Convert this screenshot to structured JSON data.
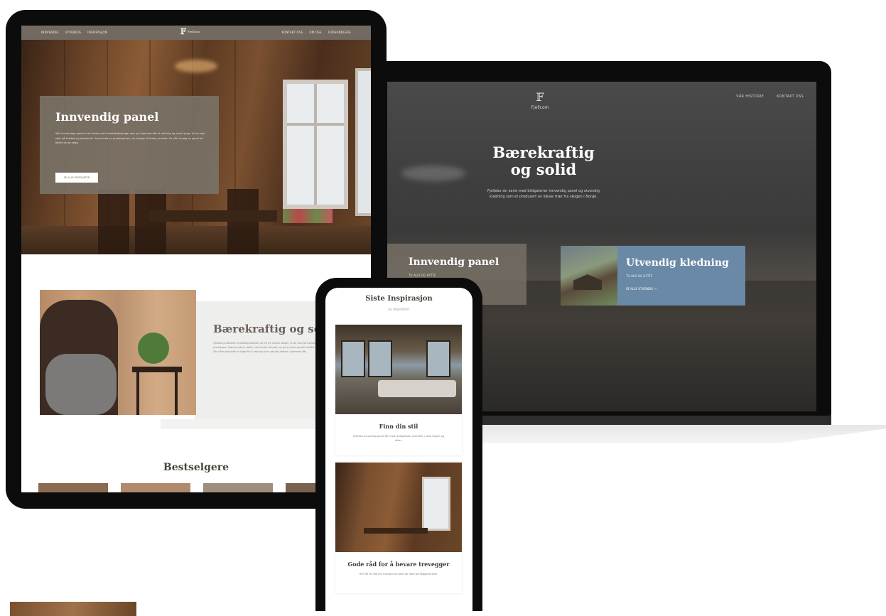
{
  "laptop": {
    "logo_name": "Fjellcom",
    "nav": [
      "VÅR HISTORIE",
      "KONTAKT OSS"
    ],
    "hero_title_line1": "Bærekraftig",
    "hero_title_line2": "og solid",
    "hero_text": "Fjellebo sin serie med bildgalerier innvendig panel og utvendig kledning som er produsert av lokale trær fra skogen i Norge.",
    "card_indoor": {
      "title": "Innvendig panel",
      "subtitle": "TIL ALLE OG HYTTE"
    },
    "card_outdoor": {
      "title": "Utvendig kledning",
      "subtitle": "TIL HUS OG HYTTE",
      "link": "SE ALLE UTVENDIG  →"
    }
  },
  "tablet": {
    "nav_left": [
      "INNVENDIG",
      "UTVENDIG",
      "INSPIRASJON"
    ],
    "nav_right": [
      "KONTAKT OSS",
      "OM OSS",
      "FORHANDLERE"
    ],
    "logo_name": "Fjellcom",
    "hero_title": "Innvendig panel",
    "hero_text": "Vårt innvendige panel er et utvalg med kvalitetsløsninger som gir hjemmet ditt et naturlig og varmt preg. Vi har lagt vekt på kvalitet og bærekraft i hvert ledd av produksjonen, fra skogen til ferdig produkt. Se vårt utvalg av panel for både tak og vegg.",
    "hero_button": "SE ALLE PRODUKTER",
    "section_title": "Bærekraftig og solid",
    "section_text": "Fjellebo produserer kvalitetsprodukter av tre fra norske skoger. Vi tar vare på naturen og sørger for bærekraftig produksjon. Trærne vokser sakte i det norske klimaet, og gir en solid og tett kvalitet som holder i mange år fremover. Alle våre produkter er laget for å vare og gi en naturlig følelse i hjemmet ditt.",
    "bestsellers_title": "Bestselgere"
  },
  "phone": {
    "title": "Siste Inspirasjon",
    "subtitle": "SE INSPIRERT",
    "cards": [
      {
        "title": "Finn din stil",
        "text": "Fjellebo innvendig panel får med ferdighilsen overflate i ulike farger og stiler."
      },
      {
        "title": "Gode råd for å bevare trevegger",
        "text": "Her får du råd om hvordan du best tar vare på veggene dine."
      }
    ]
  }
}
